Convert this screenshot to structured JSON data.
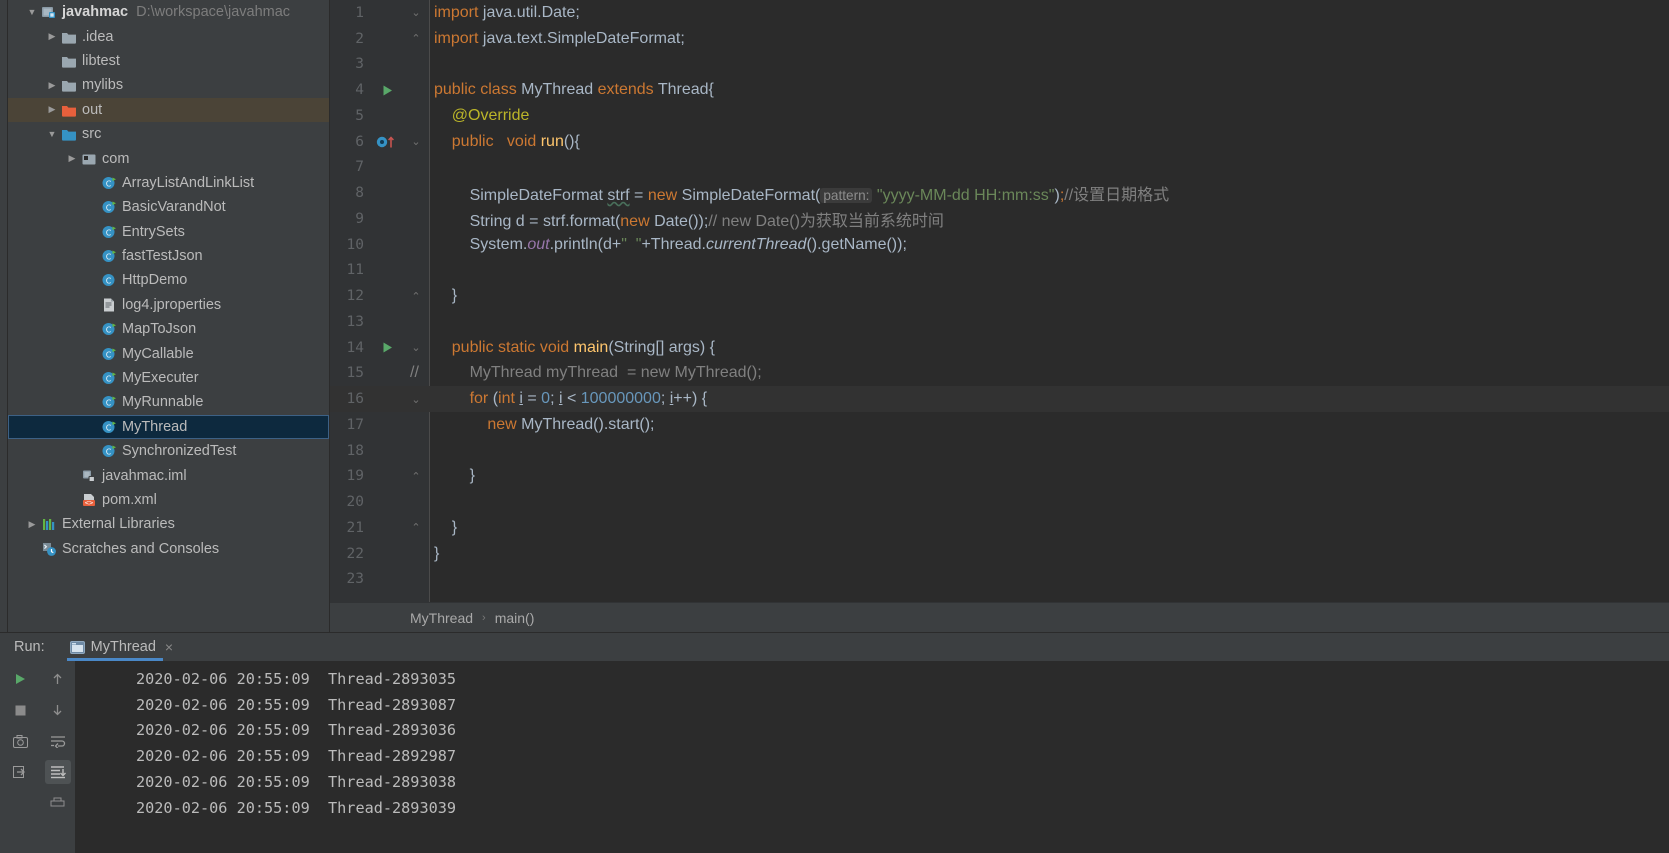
{
  "project": {
    "root_label": "javahmac",
    "root_path": "D:\\workspace\\javahmac",
    "items": [
      {
        "label": ".idea",
        "icon": "folder-icon",
        "indent": 1,
        "arrow": "collapsed",
        "selected": "none"
      },
      {
        "label": "libtest",
        "icon": "folder-icon",
        "indent": 1,
        "arrow": "none",
        "selected": "none"
      },
      {
        "label": "mylibs",
        "icon": "folder-icon",
        "indent": 1,
        "arrow": "collapsed",
        "selected": "none"
      },
      {
        "label": "out",
        "icon": "folder-orange-icon",
        "indent": 1,
        "arrow": "collapsed",
        "selected": "brown"
      },
      {
        "label": "src",
        "icon": "folder-blue-icon",
        "indent": 1,
        "arrow": "expanded",
        "selected": "none"
      },
      {
        "label": "com",
        "icon": "package-icon",
        "indent": 2,
        "arrow": "collapsed",
        "selected": "none"
      },
      {
        "label": "ArrayListAndLinkList",
        "icon": "java-class-icon",
        "indent": 3,
        "arrow": "none",
        "selected": "none"
      },
      {
        "label": "BasicVarandNot",
        "icon": "java-class-icon",
        "indent": 3,
        "arrow": "none",
        "selected": "none"
      },
      {
        "label": "EntrySets",
        "icon": "java-class-icon",
        "indent": 3,
        "arrow": "none",
        "selected": "none"
      },
      {
        "label": "fastTestJson",
        "icon": "java-class-icon",
        "indent": 3,
        "arrow": "none",
        "selected": "none"
      },
      {
        "label": "HttpDemo",
        "icon": "java-class-plain-icon",
        "indent": 3,
        "arrow": "none",
        "selected": "none"
      },
      {
        "label": "log4.jproperties",
        "icon": "properties-file-icon",
        "indent": 3,
        "arrow": "none",
        "selected": "none"
      },
      {
        "label": "MapToJson",
        "icon": "java-class-icon",
        "indent": 3,
        "arrow": "none",
        "selected": "none"
      },
      {
        "label": "MyCallable",
        "icon": "java-class-icon",
        "indent": 3,
        "arrow": "none",
        "selected": "none"
      },
      {
        "label": "MyExecuter",
        "icon": "java-class-icon",
        "indent": 3,
        "arrow": "none",
        "selected": "none"
      },
      {
        "label": "MyRunnable",
        "icon": "java-class-icon",
        "indent": 3,
        "arrow": "none",
        "selected": "none"
      },
      {
        "label": "MyThread",
        "icon": "java-class-icon",
        "indent": 3,
        "arrow": "none",
        "selected": "blue"
      },
      {
        "label": "SynchronizedTest",
        "icon": "java-class-icon",
        "indent": 3,
        "arrow": "none",
        "selected": "none"
      },
      {
        "label": "javahmac.iml",
        "icon": "iml-file-icon",
        "indent": 2,
        "arrow": "none",
        "selected": "none"
      },
      {
        "label": "pom.xml",
        "icon": "maven-pom-icon",
        "indent": 2,
        "arrow": "none",
        "selected": "none"
      },
      {
        "label": "External Libraries",
        "icon": "libraries-icon",
        "indent": 0,
        "arrow": "collapsed",
        "selected": "none"
      },
      {
        "label": "Scratches and Consoles",
        "icon": "scratches-icon",
        "indent": 0,
        "arrow": "none",
        "selected": "none"
      }
    ]
  },
  "editor": {
    "first_visible_line": 1,
    "current_line": 16,
    "run_marker_lines": [
      4,
      14
    ],
    "override_marker_line": 6,
    "breadcrumb": {
      "class": "MyThread",
      "separator": "›",
      "method": "main()"
    },
    "lines": [
      {
        "n": 1,
        "fold": "start",
        "segs": [
          {
            "t": "import ",
            "c": "kw"
          },
          {
            "t": "java.util.Date;",
            "c": "plain"
          }
        ]
      },
      {
        "n": 2,
        "fold": "end",
        "segs": [
          {
            "t": "import ",
            "c": "kw"
          },
          {
            "t": "java.text.SimpleDateFormat;",
            "c": "plain"
          }
        ]
      },
      {
        "n": 3,
        "fold": "",
        "segs": []
      },
      {
        "n": 4,
        "fold": "",
        "segs": [
          {
            "t": "public ",
            "c": "kw"
          },
          {
            "t": "class ",
            "c": "kw"
          },
          {
            "t": "MyThread ",
            "c": "plain"
          },
          {
            "t": "extends ",
            "c": "kw"
          },
          {
            "t": "Thread{",
            "c": "plain"
          }
        ]
      },
      {
        "n": 5,
        "fold": "",
        "segs": [
          {
            "t": "    @Override",
            "c": "anno"
          }
        ]
      },
      {
        "n": 6,
        "fold": "start",
        "segs": [
          {
            "t": "    ",
            "c": "plain"
          },
          {
            "t": "public ",
            "c": "kw"
          },
          {
            "t": "  ",
            "c": "plain"
          },
          {
            "t": "void ",
            "c": "kw"
          },
          {
            "t": "run",
            "c": "mtd"
          },
          {
            "t": "(){",
            "c": "plain"
          }
        ]
      },
      {
        "n": 7,
        "fold": "",
        "segs": []
      },
      {
        "n": 8,
        "fold": "",
        "segs": [
          {
            "t": "        SimpleDateFormat ",
            "c": "plain"
          },
          {
            "t": "strf",
            "c": "sq"
          },
          {
            "t": " = ",
            "c": "plain"
          },
          {
            "t": "new ",
            "c": "kw"
          },
          {
            "t": "SimpleDateFormat(",
            "c": "plain"
          },
          {
            "t": "pattern:",
            "c": "hint"
          },
          {
            "t": " ",
            "c": "plain"
          },
          {
            "t": "\"yyyy-MM-dd HH:mm:ss\"",
            "c": "str"
          },
          {
            "t": ")",
            "c": "plain"
          },
          {
            "t": ";",
            "c": "kw"
          },
          {
            "t": "//设置日期格式",
            "c": "cmt"
          }
        ]
      },
      {
        "n": 9,
        "fold": "",
        "segs": [
          {
            "t": "        String d = strf.format(",
            "c": "plain"
          },
          {
            "t": "new ",
            "c": "kw"
          },
          {
            "t": "Date());",
            "c": "plain"
          },
          {
            "t": "// new Date()为获取当前系统时间",
            "c": "cmt"
          }
        ]
      },
      {
        "n": 10,
        "fold": "",
        "segs": [
          {
            "t": "        System.",
            "c": "plain"
          },
          {
            "t": "out",
            "c": "fld"
          },
          {
            "t": ".println(d+",
            "c": "plain"
          },
          {
            "t": "\"  \"",
            "c": "str"
          },
          {
            "t": "+Thread.",
            "c": "plain"
          },
          {
            "t": "currentThread",
            "c": "stat"
          },
          {
            "t": "().getName());",
            "c": "plain"
          }
        ]
      },
      {
        "n": 11,
        "fold": "",
        "segs": []
      },
      {
        "n": 12,
        "fold": "end",
        "segs": [
          {
            "t": "    }",
            "c": "plain"
          }
        ]
      },
      {
        "n": 13,
        "fold": "",
        "segs": []
      },
      {
        "n": 14,
        "fold": "start",
        "segs": [
          {
            "t": "    ",
            "c": "plain"
          },
          {
            "t": "public static void ",
            "c": "kw"
          },
          {
            "t": "main",
            "c": "mtd"
          },
          {
            "t": "(String[] args) {",
            "c": "plain"
          }
        ]
      },
      {
        "n": 15,
        "fold": "",
        "gutter_comment": "//",
        "segs": [
          {
            "t": "        MyThread myThread  = new MyThread();",
            "c": "cmt"
          }
        ]
      },
      {
        "n": 16,
        "fold": "start",
        "segs": [
          {
            "t": "        ",
            "c": "plain"
          },
          {
            "t": "for ",
            "c": "kw"
          },
          {
            "t": "(",
            "c": "plain"
          },
          {
            "t": "int ",
            "c": "kw"
          },
          {
            "t": "i",
            "c": "und"
          },
          {
            "t": " = ",
            "c": "plain"
          },
          {
            "t": "0",
            "c": "num"
          },
          {
            "t": "; ",
            "c": "plain"
          },
          {
            "t": "i",
            "c": "und"
          },
          {
            "t": " < ",
            "c": "plain"
          },
          {
            "t": "100000000",
            "c": "num"
          },
          {
            "t": "; ",
            "c": "plain"
          },
          {
            "t": "i",
            "c": "und"
          },
          {
            "t": "++) {",
            "c": "plain"
          }
        ]
      },
      {
        "n": 17,
        "fold": "",
        "segs": [
          {
            "t": "            ",
            "c": "plain"
          },
          {
            "t": "new ",
            "c": "kw"
          },
          {
            "t": "MyThread().start();",
            "c": "plain"
          }
        ]
      },
      {
        "n": 18,
        "fold": "",
        "segs": []
      },
      {
        "n": 19,
        "fold": "end",
        "segs": [
          {
            "t": "        }",
            "c": "plain"
          }
        ]
      },
      {
        "n": 20,
        "fold": "",
        "segs": []
      },
      {
        "n": 21,
        "fold": "end",
        "segs": [
          {
            "t": "    }",
            "c": "plain"
          }
        ]
      },
      {
        "n": 22,
        "fold": "",
        "segs": [
          {
            "t": "}",
            "c": "plain"
          }
        ]
      },
      {
        "n": 23,
        "fold": "",
        "segs": []
      }
    ]
  },
  "run_panel": {
    "run_label": "Run:",
    "tab_title": "MyThread",
    "close_label": "×",
    "toolbar_left": [
      "rerun-icon",
      "stop-icon",
      "screenshot-icon",
      "export-icon"
    ],
    "toolbar_right": [
      "scroll-up-icon",
      "scroll-down-icon",
      "soft-wrap-icon",
      "scroll-to-end-icon",
      "print-icon"
    ],
    "console_lines": [
      "2020-02-06 20:55:09  Thread-2893035",
      "2020-02-06 20:55:09  Thread-2893087",
      "2020-02-06 20:55:09  Thread-2893036",
      "2020-02-06 20:55:09  Thread-2892987",
      "2020-02-06 20:55:09  Thread-2893038",
      "2020-02-06 20:55:09  Thread-2893039"
    ]
  },
  "colors": {
    "background": "#3c3f41",
    "editor_bg": "#2b2b2b",
    "accent": "#4a88c7",
    "selection": "#0d293e",
    "keyword": "#cc7832",
    "string": "#6a8759",
    "number": "#6897bb",
    "comment": "#808080",
    "method": "#ffc66d",
    "annotation": "#bbb529"
  }
}
